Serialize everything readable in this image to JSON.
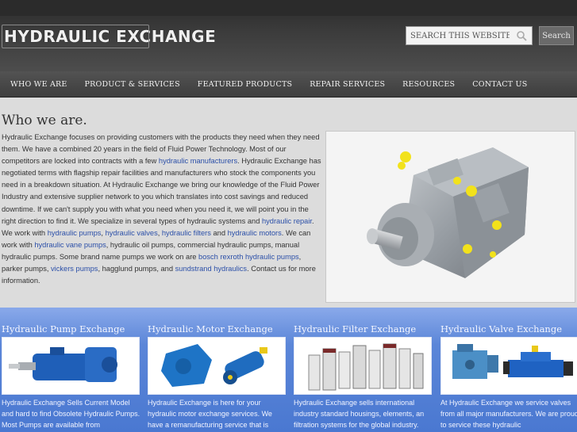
{
  "header": {
    "logo_text": "HYDRAULIC EXCHANGE",
    "search_placeholder": "SEARCH THIS WEBSITE ...",
    "search_button": "Search"
  },
  "nav": {
    "items": [
      "WHO WE ARE",
      "PRODUCT & SERVICES",
      "FEATURED PRODUCTS",
      "REPAIR SERVICES",
      "RESOURCES",
      "CONTACT US"
    ]
  },
  "main": {
    "title": "Who we are.",
    "p": [
      "Hydraulic Exchange focuses on providing customers with the products they need when they need them. We have a combined 20 years in the field of Fluid Power Technology. Most of our competitors are locked into contracts with a few ",
      "hydraulic manufacturers",
      ". Hydraulic Exchange has negotiated terms with flagship repair facilities and manufacturers who stock the components you need in a breakdown situation. At Hydraulic Exchange we bring our knowledge of the Fluid Power Industry and extensive supplier network to you which translates into cost savings and reduced downtime. If we can't supply you with what you need when you need it, we will point you in the right direction to find it. We specialize in several types of hydraulic systems and ",
      "hydraulic repair",
      ". We work with ",
      "hydraulic pumps",
      ", ",
      "hydraulic valves",
      ", ",
      "hydraulic filters",
      " and ",
      "hydraulic motors",
      ". We can work with ",
      "hydraulic vane pumps",
      ", hydraulic oil pumps, commercial hydraulic pumps, manual hydraulic pumps. Some brand name pumps we work on are ",
      "bosch rexroth hydraulic pumps",
      ", parker pumps, ",
      "vickers pumps",
      ", hagglund pumps, and ",
      "sundstrand hydraulics",
      ". Contact us for more information."
    ]
  },
  "columns": [
    {
      "title": "Hydraulic Pump Exchange",
      "text": "Hydraulic Exchange Sells Current Model and hard to find Obsolete Hydraulic Pumps.  Most Pumps are available from"
    },
    {
      "title": "Hydraulic Motor Exchange",
      "text": "Hydraulic Exchange is here for your hydraulic motor exchange services. We have a remanufacturing service that is"
    },
    {
      "title": "Hydraulic Filter Exchange",
      "text": "Hydraulic Exchange sells international industry standard housings, elements, an filtration systems for the global industry."
    },
    {
      "title": "Hydraulic Valve Exchange",
      "text": "At Hydraulic Exchange we service valves from all major manufacturers. We are proud to service these hydraulic"
    }
  ],
  "colors": {
    "link": "#2b4fa8",
    "band": "#4a78d1",
    "header": "#3c3c3c",
    "pump_blue": "#1f5fb8",
    "pump_gray": "#8a8f95",
    "accent_yellow": "#f2e21b"
  }
}
